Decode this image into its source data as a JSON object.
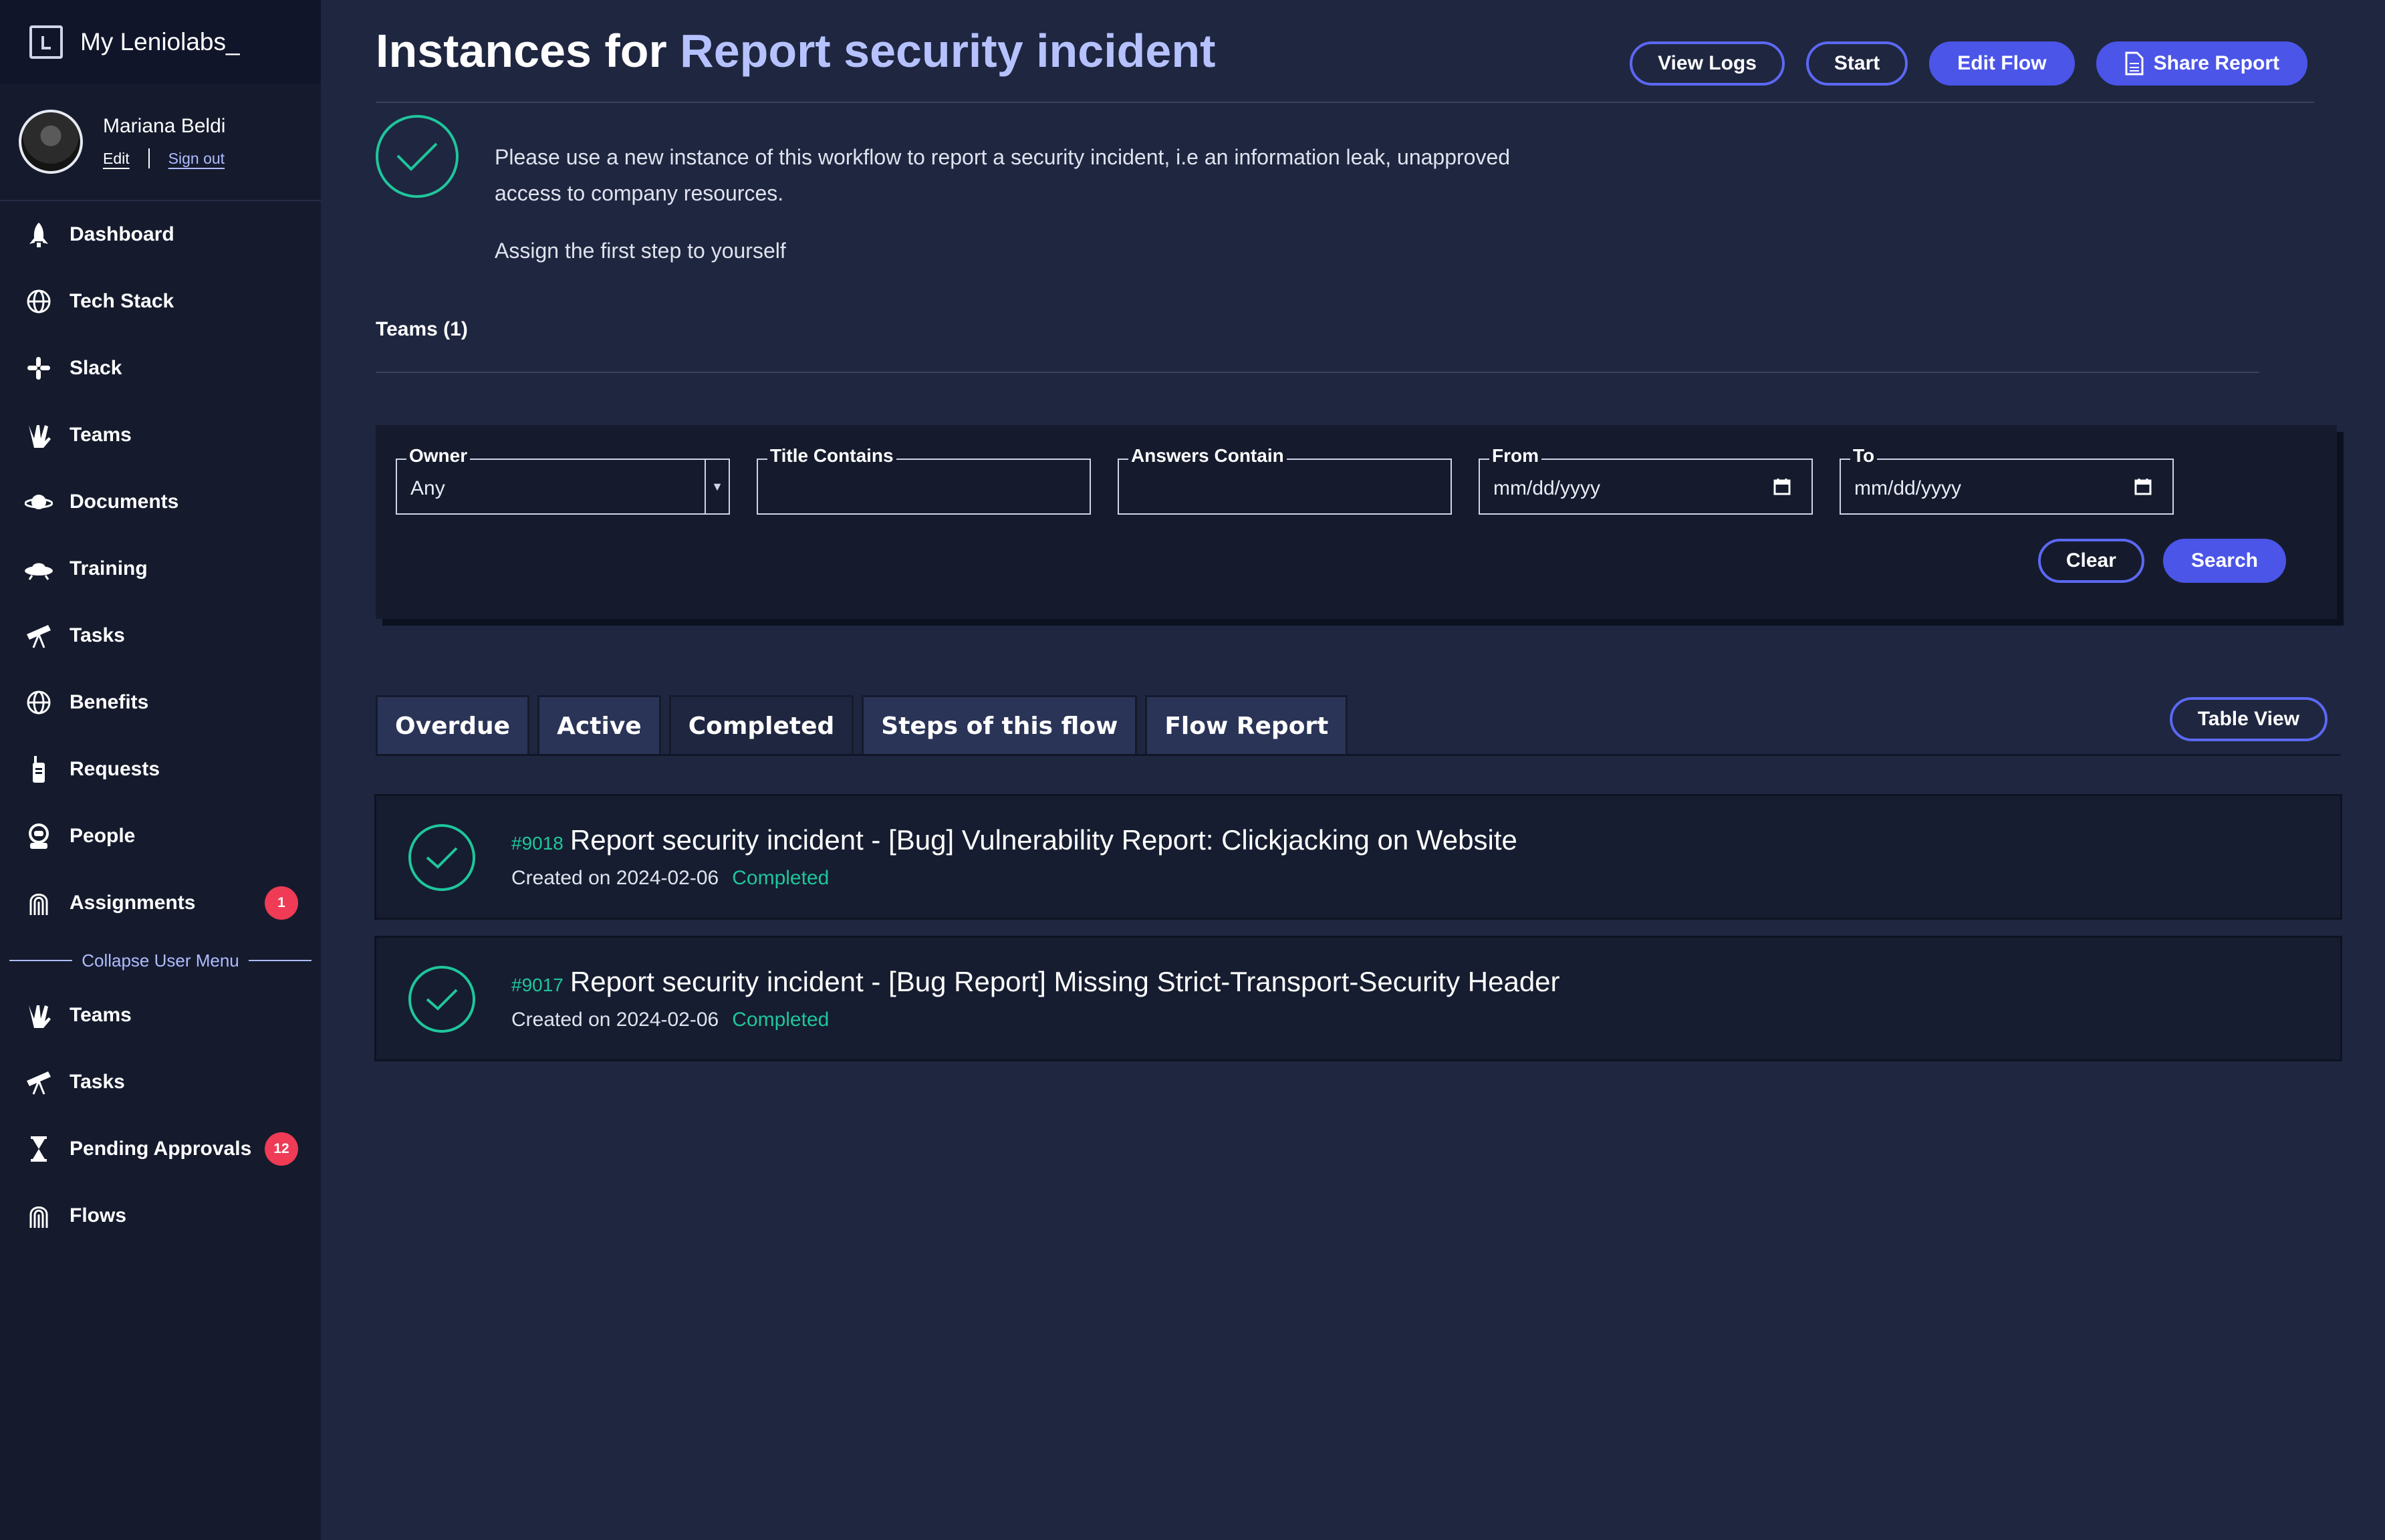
{
  "sidebar": {
    "brand": "My Leniolabs_",
    "user": {
      "name": "Mariana Beldi",
      "edit": "Edit",
      "signout": "Sign out"
    },
    "items": [
      {
        "label": "Dashboard",
        "icon": "rocket-icon"
      },
      {
        "label": "Tech Stack",
        "icon": "globe-icon"
      },
      {
        "label": "Slack",
        "icon": "slack-icon"
      },
      {
        "label": "Teams",
        "icon": "vulcan-hand-icon"
      },
      {
        "label": "Documents",
        "icon": "planet-icon"
      },
      {
        "label": "Training",
        "icon": "ufo-icon"
      },
      {
        "label": "Tasks",
        "icon": "telescope-icon"
      },
      {
        "label": "Benefits",
        "icon": "globe-icon"
      },
      {
        "label": "Requests",
        "icon": "walkie-talkie-icon"
      },
      {
        "label": "People",
        "icon": "astronaut-icon"
      },
      {
        "label": "Assignments",
        "icon": "fingerprint-icon",
        "badge": "1"
      }
    ],
    "collapse_label": "Collapse User Menu",
    "admin_items": [
      {
        "label": "Teams",
        "icon": "vulcan-hand-icon"
      },
      {
        "label": "Tasks",
        "icon": "telescope-icon"
      },
      {
        "label": "Pending Approvals",
        "icon": "hourglass-icon",
        "badge": "12"
      },
      {
        "label": "Flows",
        "icon": "fingerprint-icon"
      }
    ]
  },
  "header": {
    "title_prefix": "Instances for ",
    "title_flow": "Report security incident",
    "actions": {
      "view_logs": "View Logs",
      "start": "Start",
      "edit_flow": "Edit Flow",
      "share_report": "Share Report"
    }
  },
  "intro": {
    "line1": "Please use a new instance of this workflow to report a security incident, i.e an information leak, unapproved access to company resources.",
    "line2": "Assign the first step to yourself"
  },
  "teams_count": "Teams (1)",
  "filters": {
    "owner_label": "Owner",
    "owner_value": "Any",
    "title_label": "Title Contains",
    "answers_label": "Answers Contain",
    "from_label": "From",
    "from_value": "mm/dd/yyyy",
    "to_label": "To",
    "to_value": "mm/dd/yyyy",
    "clear": "Clear",
    "search": "Search"
  },
  "tabs": [
    "Overdue",
    "Active",
    "Completed",
    "Steps of this flow",
    "Flow Report"
  ],
  "active_tab": "Completed",
  "table_view": "Table View",
  "instances": [
    {
      "id": "#9018",
      "title": "Report security incident - [Bug] Vulnerability Report: Clickjacking on Website",
      "created": "Created on 2024-02-06",
      "status": "Completed"
    },
    {
      "id": "#9017",
      "title": "Report security incident - [Bug Report] Missing Strict-Transport-Security Header",
      "created": "Created on 2024-02-06",
      "status": "Completed"
    }
  ],
  "colors": {
    "accent": "#4b55e8",
    "success": "#1fc69b",
    "badge": "#ef3b55",
    "title_accent": "#b6c2ff"
  }
}
